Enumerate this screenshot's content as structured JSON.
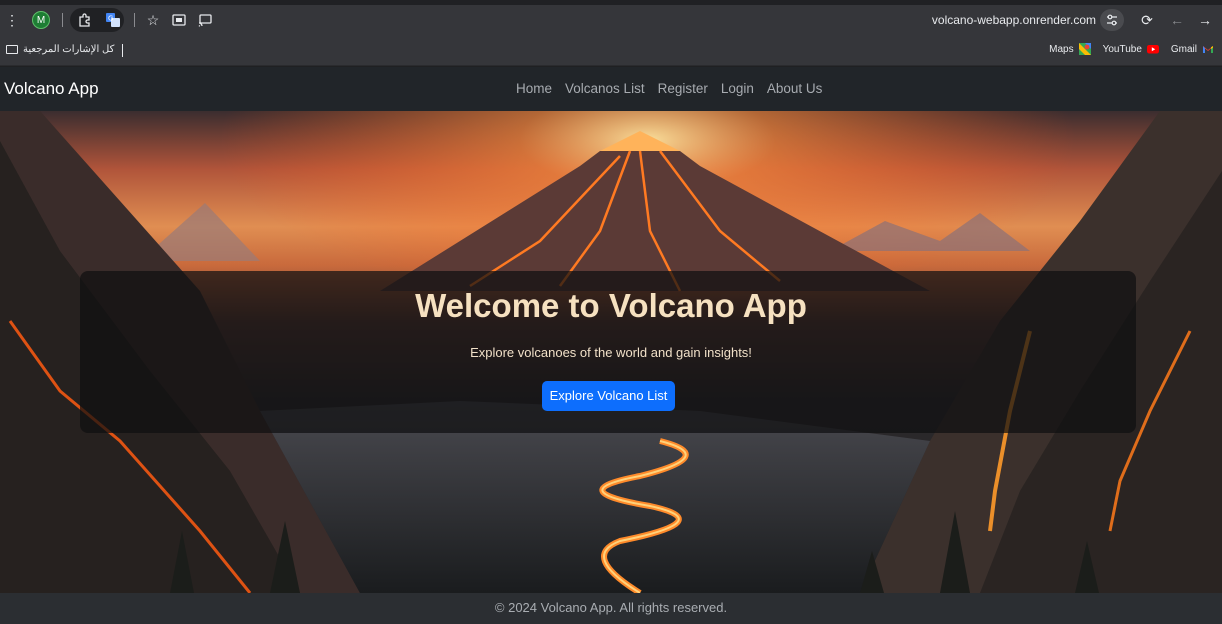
{
  "browser": {
    "url": "volcano-webapp.onrender.com",
    "profile_initial": "M",
    "bookmarks_folder": "كل الإشارات المرجعية",
    "bookmarks": [
      {
        "label": "Maps",
        "icon": "maps-icon"
      },
      {
        "label": "YouTube",
        "icon": "youtube-icon"
      },
      {
        "label": "Gmail",
        "icon": "gmail-icon"
      }
    ]
  },
  "navbar": {
    "brand": "Volcano App",
    "links": [
      "Home",
      "Volcanos List",
      "Register",
      "Login",
      "About Us"
    ]
  },
  "hero": {
    "title": "Welcome to Volcano App",
    "subtitle": "Explore volcanoes of the world and gain insights!",
    "button_label": "Explore Volcano List"
  },
  "footer": {
    "text": "© 2024 Volcano App. All rights reserved."
  },
  "colors": {
    "navbar_bg": "#212529",
    "primary_button": "#0d6efd",
    "lava": "#ff6a1a"
  }
}
